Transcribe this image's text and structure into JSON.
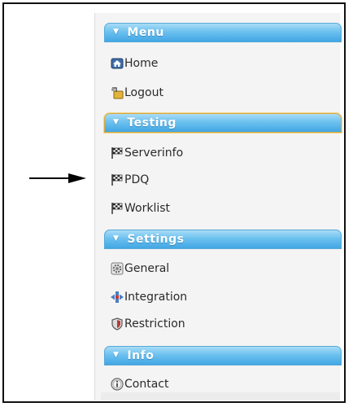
{
  "sections": [
    {
      "title": "Menu",
      "items": [
        {
          "label": "Home",
          "icon": "home-icon"
        },
        {
          "label": "Logout",
          "icon": "logout-icon"
        }
      ]
    },
    {
      "title": "Testing",
      "items": [
        {
          "label": "Serverinfo",
          "icon": "checkered-flag-icon"
        },
        {
          "label": "PDQ",
          "icon": "checkered-flag-icon"
        },
        {
          "label": "Worklist",
          "icon": "checkered-flag-icon"
        }
      ]
    },
    {
      "title": "Settings",
      "items": [
        {
          "label": "General",
          "icon": "gear-icon"
        },
        {
          "label": "Integration",
          "icon": "integration-icon"
        },
        {
          "label": "Restriction",
          "icon": "shield-icon"
        }
      ]
    },
    {
      "title": "Info",
      "items": [
        {
          "label": "Contact",
          "icon": "info-icon"
        }
      ]
    }
  ],
  "colors": {
    "header_gradient_top": "#a9dcf7",
    "header_gradient_bottom": "#42a6e4",
    "active_header_border": "#d8a93a",
    "panel_background": "#f4f4f4"
  }
}
